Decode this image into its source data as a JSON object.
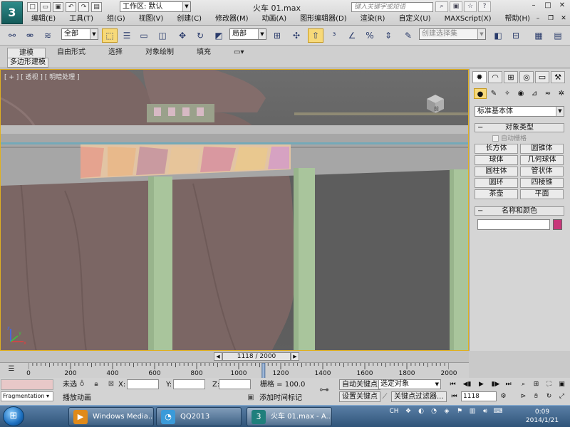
{
  "window": {
    "title": "火车 01.max",
    "logo": "3",
    "workspace_label": "工作区: 默认",
    "help_search_placeholder": "键入关键字或短语"
  },
  "quick_access": [
    "new-icon",
    "open-icon",
    "save-icon",
    "undo-icon",
    "redo-icon",
    "project-icon"
  ],
  "menu": [
    "编辑(E)",
    "工具(T)",
    "组(G)",
    "视图(V)",
    "创建(C)",
    "修改器(M)",
    "动画(A)",
    "图形编辑器(D)",
    "渲染(R)",
    "自定义(U)",
    "MAXScript(X)",
    "帮助(H)"
  ],
  "toolbar": {
    "selection_filter": "全部",
    "ref_coord": "局部",
    "named_selection_placeholder": "创建选择集"
  },
  "ribbon": {
    "tabs": [
      "建模",
      "自由形式",
      "选择",
      "对象绘制",
      "填充"
    ],
    "active_tab": "建模",
    "panel": "多边形建模"
  },
  "viewport": {
    "label": "[ + ] [ 透视 ] [ 明暗处理 ]",
    "viewcube_label": "前",
    "axis": {
      "x": "x",
      "y": "y",
      "z": "z"
    },
    "colors": {
      "background": "#606060",
      "frame": "#e0b020",
      "body": "#7b6664",
      "pillar": "#a9c59c",
      "platform": "#a6a6a6"
    }
  },
  "timeline": {
    "frame_display": "1118 / 2000",
    "ticks": [
      "0",
      "200",
      "400",
      "600",
      "800",
      "1000",
      "1200",
      "1400",
      "1600",
      "1800",
      "2000"
    ]
  },
  "status": {
    "fragmentation": "Fragmentation",
    "selection_text": "未选",
    "x_label": "X:",
    "y_label": "Y:",
    "z_label": "Z:",
    "grid_text": "栅格 = 100.0",
    "prompt": "播放动画",
    "add_time_tag": "添加时间标记",
    "auto_key": "自动关键点",
    "set_key": "设置关键点",
    "key_mode_select": "选定对象",
    "key_filters": "关键点过滤器...",
    "current_frame": "1118"
  },
  "command_panel": {
    "category": "标准基本体",
    "object_type_title": "对象类型",
    "auto_grid": "自动栅格",
    "objects": [
      "长方体",
      "圆锥体",
      "球体",
      "几何球体",
      "圆柱体",
      "管状体",
      "圆环",
      "四棱锥",
      "茶壶",
      "平面"
    ],
    "name_color_title": "名称和颜色",
    "swatch_color": "#c8367a"
  },
  "taskbar": {
    "apps": [
      {
        "label": "Windows Media...",
        "icon": "media-player-icon"
      },
      {
        "label": "QQ2013",
        "icon": "qq-icon"
      },
      {
        "label": "火车 01.max - A...",
        "icon": "3dsmax-icon"
      }
    ],
    "ime": "CH",
    "time": "0:09",
    "date": "2014/1/21"
  }
}
